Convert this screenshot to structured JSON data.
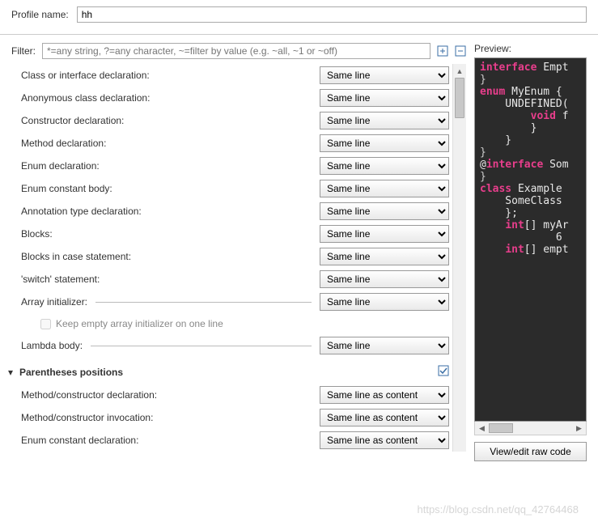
{
  "profile": {
    "label": "Profile name:",
    "value": "hh"
  },
  "filter": {
    "label": "Filter:",
    "placeholder": "*=any string, ?=any character, ~=filter by value (e.g. ~all, ~1 or ~off)"
  },
  "groups": [
    {
      "title": "",
      "rows": [
        {
          "label": "Class or interface declaration:",
          "value": "Same line",
          "rule": false
        },
        {
          "label": "Anonymous class declaration:",
          "value": "Same line",
          "rule": false
        },
        {
          "label": "Constructor declaration:",
          "value": "Same line",
          "rule": false
        },
        {
          "label": "Method declaration:",
          "value": "Same line",
          "rule": false
        },
        {
          "label": "Enum declaration:",
          "value": "Same line",
          "rule": false
        },
        {
          "label": "Enum constant body:",
          "value": "Same line",
          "rule": false
        },
        {
          "label": "Annotation type declaration:",
          "value": "Same line",
          "rule": false
        },
        {
          "label": "Blocks:",
          "value": "Same line",
          "rule": false
        },
        {
          "label": "Blocks in case statement:",
          "value": "Same line",
          "rule": false
        },
        {
          "label": "'switch' statement:",
          "value": "Same line",
          "rule": false
        },
        {
          "label": "Array initializer:",
          "value": "Same line",
          "rule": true,
          "sub": {
            "label": "Keep empty array initializer on one line",
            "checked": false
          }
        },
        {
          "label": "Lambda body:",
          "value": "Same line",
          "rule": true
        }
      ]
    },
    {
      "title": "Parentheses positions",
      "rows": [
        {
          "label": "Method/constructor declaration:",
          "value": "Same line as content",
          "rule": false
        },
        {
          "label": "Method/constructor invocation:",
          "value": "Same line as content",
          "rule": false
        },
        {
          "label": "Enum constant declaration:",
          "value": "Same line as content",
          "rule": false
        }
      ]
    }
  ],
  "preview": {
    "label": "Preview:",
    "lines": [
      [
        {
          "t": "interface ",
          "c": "kw"
        },
        {
          "t": "Empt",
          "c": "id"
        }
      ],
      [
        {
          "t": "}",
          "c": "br"
        }
      ],
      [
        {
          "t": "",
          "c": "id"
        }
      ],
      [
        {
          "t": "enum ",
          "c": "kw"
        },
        {
          "t": "MyEnum {",
          "c": "id"
        }
      ],
      [
        {
          "t": "    UNDEFINED(",
          "c": "id"
        }
      ],
      [
        {
          "t": "        ",
          "c": "id"
        },
        {
          "t": "void ",
          "c": "kw"
        },
        {
          "t": "f",
          "c": "id"
        }
      ],
      [
        {
          "t": "        }",
          "c": "id"
        }
      ],
      [
        {
          "t": "    }",
          "c": "id"
        }
      ],
      [
        {
          "t": "}",
          "c": "br"
        }
      ],
      [
        {
          "t": "",
          "c": "id"
        }
      ],
      [
        {
          "t": "@",
          "c": "id"
        },
        {
          "t": "interface ",
          "c": "kw"
        },
        {
          "t": "Som",
          "c": "id"
        }
      ],
      [
        {
          "t": "}",
          "c": "br"
        }
      ],
      [
        {
          "t": "",
          "c": "id"
        }
      ],
      [
        {
          "t": "class ",
          "c": "kw"
        },
        {
          "t": "Example ",
          "c": "id"
        }
      ],
      [
        {
          "t": "    SomeClass ",
          "c": "id"
        }
      ],
      [
        {
          "t": "    };",
          "c": "id"
        }
      ],
      [
        {
          "t": "    ",
          "c": "id"
        },
        {
          "t": "int",
          "c": "kw"
        },
        {
          "t": "[] myAr",
          "c": "id"
        }
      ],
      [
        {
          "t": "            6 ",
          "c": "id"
        }
      ],
      [
        {
          "t": "    ",
          "c": "id"
        },
        {
          "t": "int",
          "c": "kw"
        },
        {
          "t": "[] empt",
          "c": "id"
        }
      ]
    ],
    "button": "View/edit raw code"
  },
  "watermark": "https://blog.csdn.net/qq_42764468"
}
